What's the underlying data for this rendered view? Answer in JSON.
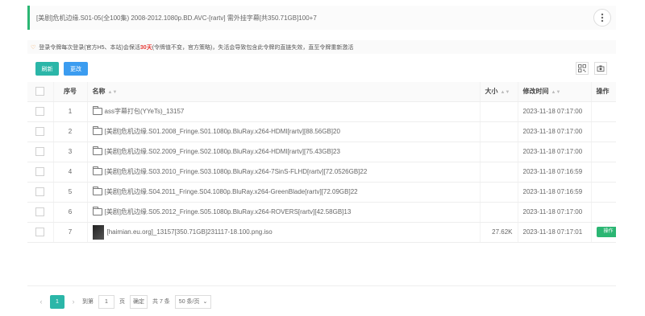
{
  "header": {
    "title": "[美剧]危机边缘.S01-05(全100集) 2008-2012.1080p.BD.AVC-[rartv] 需外挂字幕[共350.71GB]100+7",
    "more_icon": "vertical-ellipsis-icon"
  },
  "notice": {
    "icon": "warning-icon",
    "text_before": "登录令牌每次登录(官方H5、本站)会保活",
    "highlight": "30天",
    "text_after": "(令牌值不变，官方策略)，失活会导致包含此令牌的直链失效，直至令牌重新激活"
  },
  "toolbar": {
    "refresh_label": "刷新",
    "more_label": "更改",
    "icons": [
      "qr-code-icon",
      "screenshot-icon"
    ]
  },
  "table": {
    "headers": {
      "index": "序号",
      "name": "名称",
      "size": "大小",
      "modified": "修改时间",
      "action": "操作"
    },
    "rows": [
      {
        "index": "1",
        "type": "folder",
        "name": "ass字幕打包(YYeTs)_13157",
        "size": "",
        "modified": "2023-11-18 07:17:00",
        "action": ""
      },
      {
        "index": "2",
        "type": "folder",
        "name": "[美剧]危机边缘.S01.2008_Fringe.S01.1080p.BluRay.x264-HDMI[rartv][88.56GB]20",
        "size": "",
        "modified": "2023-11-18 07:17:00",
        "action": ""
      },
      {
        "index": "3",
        "type": "folder",
        "name": "[美剧]危机边缘.S02.2009_Fringe.S02.1080p.BluRay.x264-HDMI[rartv][75.43GB]23",
        "size": "",
        "modified": "2023-11-18 07:17:00",
        "action": ""
      },
      {
        "index": "4",
        "type": "folder",
        "name": "[美剧]危机边缘.S03.2010_Fringe.S03.1080p.BluRay.x264-7SinS-FLHD[rartv][72.0526GB]22",
        "size": "",
        "modified": "2023-11-18 07:16:59",
        "action": ""
      },
      {
        "index": "5",
        "type": "folder",
        "name": "[美剧]危机边缘.S04.2011_Fringe.S04.1080p.BluRay.x264-GreenBlade[rartv][72.09GB]22",
        "size": "",
        "modified": "2023-11-18 07:16:59",
        "action": ""
      },
      {
        "index": "6",
        "type": "folder",
        "name": "[美剧]危机边缘.S05.2012_Fringe.S05.1080p.BluRay.x264-ROVERS[rartv][42.58GB]13",
        "size": "",
        "modified": "2023-11-18 07:17:00",
        "action": ""
      },
      {
        "index": "7",
        "type": "image",
        "name": "[haimian.eu.org]_13157[350.71GB]231117-18.100.png.iso",
        "size": "27.62K",
        "modified": "2023-11-18 07:17:01",
        "action": "操作"
      }
    ]
  },
  "pager": {
    "current": "1",
    "goto_label": "到第",
    "goto_value": "1",
    "page_unit": "页",
    "confirm_label": "确定",
    "total_label": "共 7 条",
    "page_size": "50 条/页"
  },
  "colors": {
    "accent": "#2bb673",
    "teal": "#2bb6a8",
    "blue": "#3b9cf0",
    "highlight": "#e53935"
  }
}
